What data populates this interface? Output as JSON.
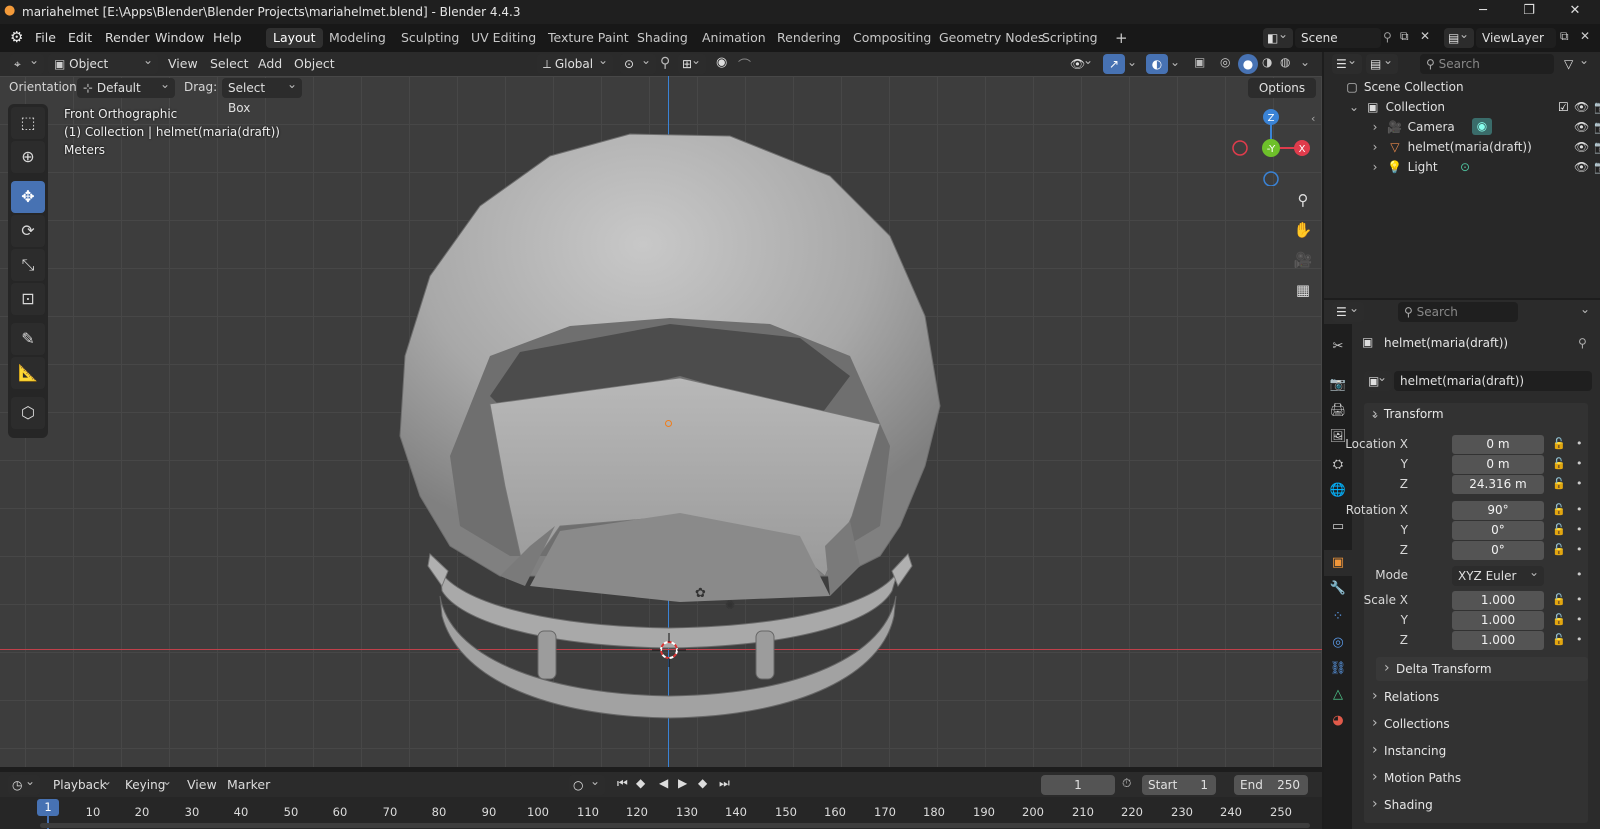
{
  "window": {
    "title": "mariahelmet [E:\\Apps\\Blender\\Blender Projects\\mariahelmet.blend] - Blender 4.4.3"
  },
  "menu": [
    "File",
    "Edit",
    "Render",
    "Window",
    "Help"
  ],
  "workspaces": [
    "Layout",
    "Modeling",
    "Sculpting",
    "UV Editing",
    "Texture Paint",
    "Shading",
    "Animation",
    "Rendering",
    "Compositing",
    "Geometry Nodes",
    "Scripting"
  ],
  "scene": {
    "scene_name": "Scene",
    "view_layer": "ViewLayer"
  },
  "viewport_header": {
    "mode": "Object Mode",
    "menus": [
      "View",
      "Select",
      "Add",
      "Object"
    ],
    "transform_orientation": "Global",
    "options": "Options"
  },
  "tool_settings": {
    "orientation_label": "Orientation:",
    "orientation_value": "Default",
    "drag_label": "Drag:",
    "drag_value": "Select Box"
  },
  "viewport_info": {
    "view": "Front Orthographic",
    "collection": "(1) Collection | helmet(maria(draft))",
    "units": "Meters"
  },
  "gizmo": {
    "z": "Z",
    "y": "-Y",
    "x": "X"
  },
  "outliner": {
    "search_placeholder": "Search",
    "root": "Scene Collection",
    "collection": "Collection",
    "items": [
      "Camera",
      "helmet(maria(draft))",
      "Light"
    ]
  },
  "properties": {
    "search_placeholder": "Search",
    "object_name": "helmet(maria(draft))",
    "object_field": "helmet(maria(draft))",
    "transform_label": "Transform",
    "location": {
      "label": "Location X",
      "x": "0 m",
      "y": "0 m",
      "z": "24.316 m"
    },
    "rotation": {
      "label": "Rotation X",
      "x": "90°",
      "y": "0°",
      "z": "0°"
    },
    "mode_label": "Mode",
    "mode_value": "XYZ Euler",
    "scale": {
      "label": "Scale X",
      "x": "1.000",
      "y": "1.000",
      "z": "1.000"
    },
    "axis_y": "Y",
    "axis_z": "Z",
    "delta_transform": "Delta Transform",
    "panels": [
      "Relations",
      "Collections",
      "Instancing",
      "Motion Paths",
      "Shading"
    ]
  },
  "timeline": {
    "menus": [
      "Playback",
      "Keying",
      "View",
      "Marker"
    ],
    "current_frame": "1",
    "start_label": "Start",
    "start_value": "1",
    "end_label": "End",
    "end_value": "250",
    "ticks": [
      "1",
      "10",
      "20",
      "30",
      "40",
      "50",
      "60",
      "70",
      "80",
      "90",
      "100",
      "110",
      "120",
      "130",
      "140",
      "150",
      "160",
      "170",
      "180",
      "190",
      "200",
      "210",
      "220",
      "230",
      "240",
      "250"
    ]
  },
  "colors": {
    "accent": "#4772b3",
    "x_axis": "#e03c4c",
    "y_axis": "#6ec02a",
    "z_axis": "#3a83d6",
    "object_origin": "#f07d1a"
  }
}
